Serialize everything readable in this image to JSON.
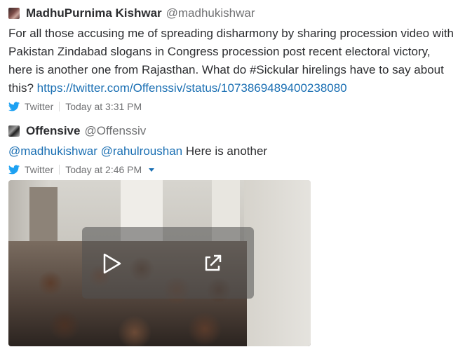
{
  "tweets": [
    {
      "author_name": "MadhuPurnima Kishwar",
      "author_handle": "@madhukishwar",
      "text": "For all those accusing me of spreading disharmony by sharing procession video with Pakistan Zindabad slogans in Congress procession post recent electoral victory, here is another one from Rajasthan. What do #Sickular hirelings have to say about this?",
      "link": "https://twitter.com/Offenssiv/status/1073869489400238080",
      "source": "Twitter",
      "timestamp": "Today at 3:31 PM"
    },
    {
      "author_name": "Offensive",
      "author_handle": "@Offenssiv",
      "mention_1": "@madhukishwar",
      "mention_2": "@rahulroushan",
      "text": "Here is another",
      "source": "Twitter",
      "timestamp": "Today at 2:46 PM"
    }
  ],
  "media": {
    "play_icon": "play-icon",
    "expand_icon": "external-link-icon"
  },
  "colors": {
    "link": "#1a6fb3",
    "twitter_bird": "#1da1f2",
    "muted": "#717274",
    "text": "#2c2d30"
  }
}
